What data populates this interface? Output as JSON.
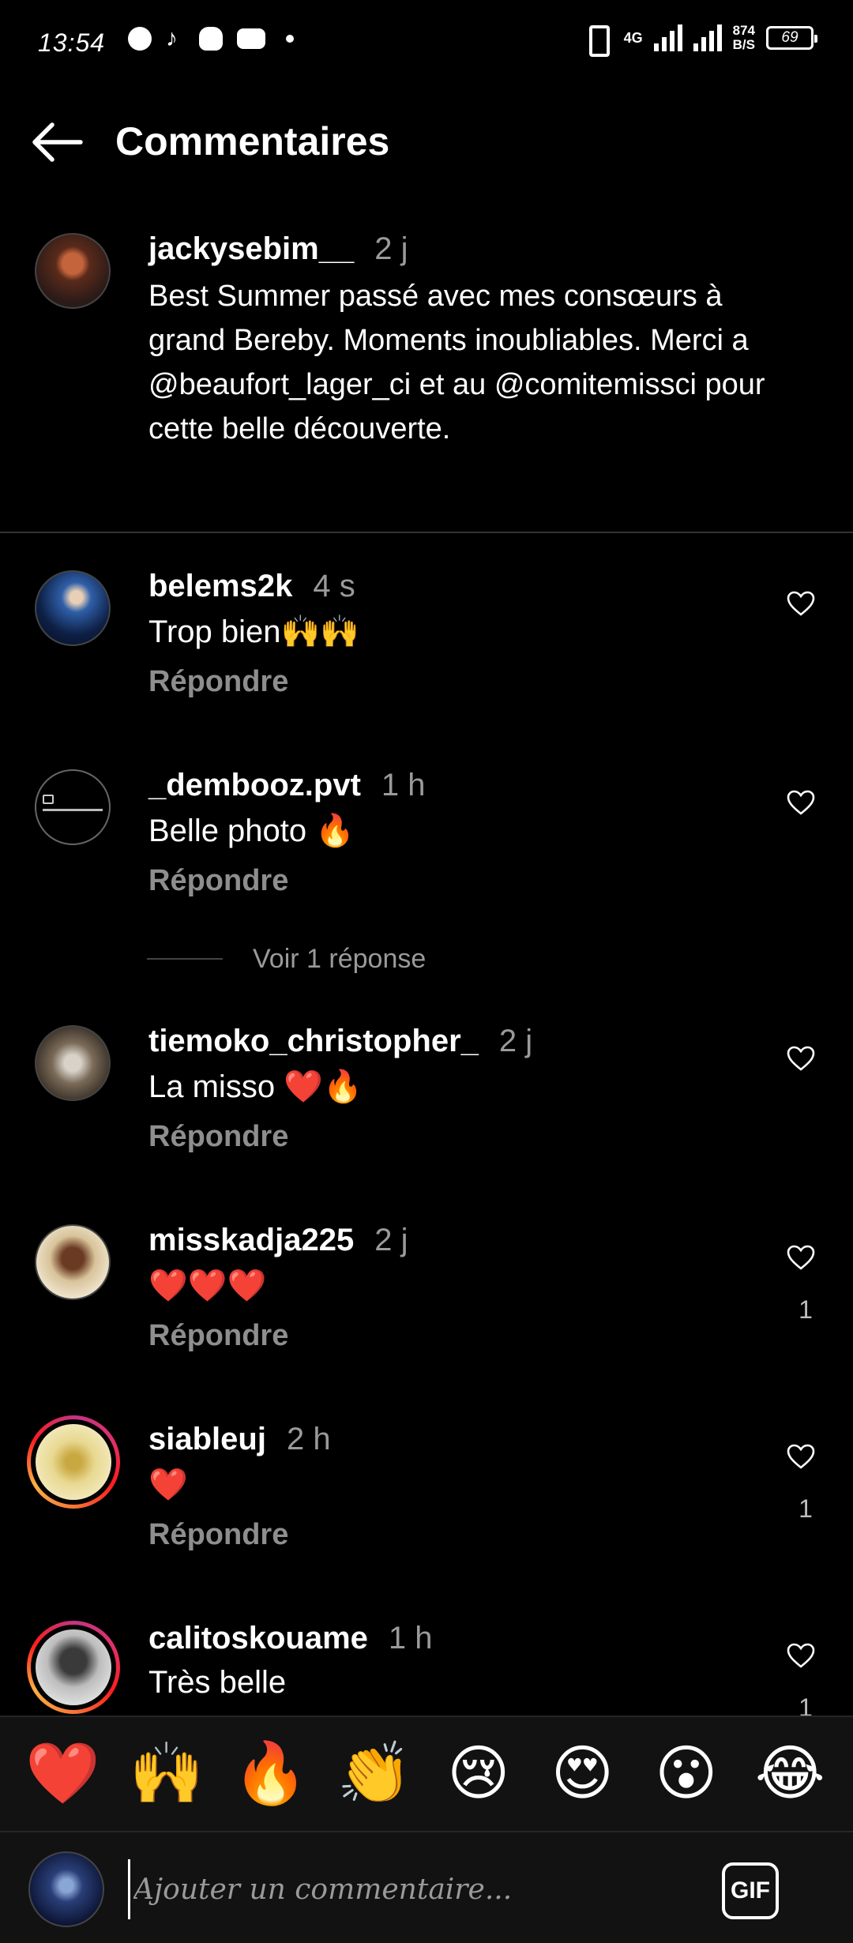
{
  "status_bar": {
    "time": "13:54",
    "network": "4G",
    "net_speed_value": "874",
    "net_speed_unit": "B/S",
    "battery": "69"
  },
  "header": {
    "title": "Commentaires"
  },
  "caption": {
    "username": "jackysebim__",
    "time": "2 j",
    "text": "Best Summer passé avec mes consœurs à grand Bereby. Moments inoubliables. Merci a @beaufort_lager_ci et au @comitemissci pour cette belle découverte."
  },
  "comments": [
    {
      "username": "belems2k",
      "time": "4 s",
      "text": "Trop bien🙌🙌",
      "reply_label": "Répondre",
      "likes": ""
    },
    {
      "username": "_dembooz.pvt",
      "time": "1 h",
      "text": "Belle photo 🔥",
      "reply_label": "Répondre",
      "likes": ""
    },
    {
      "username": "tiemoko_christopher_",
      "time": "2 j",
      "text": "La misso ❤️🔥",
      "reply_label": "Répondre",
      "likes": ""
    },
    {
      "username": "misskadja225",
      "time": "2 j",
      "text": "❤️❤️❤️",
      "reply_label": "Répondre",
      "likes": "1"
    },
    {
      "username": "siableuj",
      "time": "2 h",
      "text": "❤️",
      "reply_label": "Répondre",
      "likes": "1"
    },
    {
      "username": "calitoskouame",
      "time": "1 h",
      "text": "Très belle",
      "reply_label": "",
      "likes": "1"
    }
  ],
  "view_replies": "Voir 1 réponse",
  "emoji_bar": [
    "❤️",
    "🙌",
    "🔥",
    "👏",
    "😢",
    "😍",
    "😮",
    "😂"
  ],
  "input": {
    "placeholder": "Ajouter un commentaire...",
    "gif_label": "GIF"
  },
  "colors": {
    "background": "#000000",
    "secondary_text": "#9a9a9a",
    "bar_background": "#121212"
  }
}
